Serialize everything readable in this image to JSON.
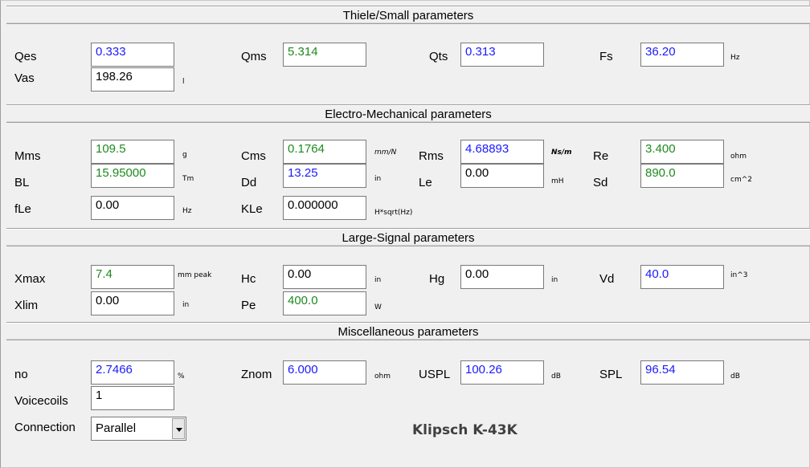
{
  "sections": {
    "thiele_small": "Thiele/Small parameters",
    "electro_mechanical": "Electro-Mechanical parameters",
    "large_signal": "Large-Signal parameters",
    "miscellaneous": "Miscellaneous parameters"
  },
  "thiele_small": {
    "qes": {
      "label": "Qes",
      "value": "0.333"
    },
    "qms": {
      "label": "Qms",
      "value": "5.314"
    },
    "qts": {
      "label": "Qts",
      "value": "0.313"
    },
    "fs": {
      "label": "Fs",
      "value": "36.20",
      "unit": "Hz"
    },
    "vas": {
      "label": "Vas",
      "value": "198.26",
      "unit": "l"
    }
  },
  "electro_mechanical": {
    "mms": {
      "label": "Mms",
      "value": "109.5",
      "unit": "g"
    },
    "cms": {
      "label": "Cms",
      "value": "0.1764",
      "unit": "mm/N"
    },
    "rms": {
      "label": "Rms",
      "value": "4.68893",
      "unit": "Ns/m"
    },
    "re": {
      "label": "Re",
      "value": "3.400",
      "unit": "ohm"
    },
    "bl": {
      "label": "BL",
      "value": "15.95000",
      "unit": "Tm"
    },
    "dd": {
      "label": "Dd",
      "value": "13.25",
      "unit": "in"
    },
    "le": {
      "label": "Le",
      "value": "0.00",
      "unit": "mH"
    },
    "sd": {
      "label": "Sd",
      "value": "890.0",
      "unit": "cm^2"
    },
    "fle": {
      "label": "fLe",
      "value": "0.00",
      "unit": "Hz"
    },
    "kle": {
      "label": "KLe",
      "value": "0.000000",
      "unit": "H*sqrt(Hz)"
    }
  },
  "large_signal": {
    "xmax": {
      "label": "Xmax",
      "value": "7.4",
      "unit": "mm  peak"
    },
    "hc": {
      "label": "Hc",
      "value": "0.00",
      "unit": "in"
    },
    "hg": {
      "label": "Hg",
      "value": "0.00",
      "unit": "in"
    },
    "vd": {
      "label": "Vd",
      "value": "40.0",
      "unit": "in^3"
    },
    "xlim": {
      "label": "Xlim",
      "value": "0.00",
      "unit": "in"
    },
    "pe": {
      "label": "Pe",
      "value": "400.0",
      "unit": "W"
    }
  },
  "miscellaneous": {
    "no": {
      "label": "no",
      "value": "2.7466",
      "unit": "%"
    },
    "znom": {
      "label": "Znom",
      "value": "6.000",
      "unit": "ohm"
    },
    "uspl": {
      "label": "USPL",
      "value": "100.26",
      "unit": "dB"
    },
    "spl": {
      "label": "SPL",
      "value": "96.54",
      "unit": "dB"
    },
    "voicecoils": {
      "label": "Voicecoils",
      "value": "1"
    },
    "connection": {
      "label": "Connection",
      "value": "Parallel"
    }
  },
  "model_name": "Klipsch K-43K",
  "colors": {
    "calculated": "#1a1aff",
    "entered": "#1e8a1e"
  }
}
